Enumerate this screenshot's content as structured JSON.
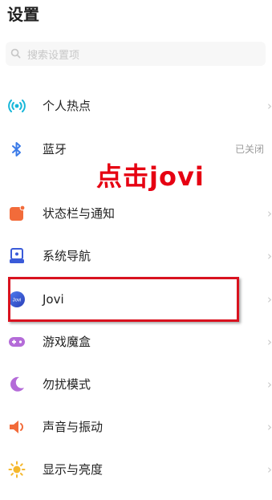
{
  "header": {
    "title": "设置"
  },
  "search": {
    "placeholder": "搜索设置项",
    "icon": "search-icon"
  },
  "rows": [
    {
      "label": "个人热点",
      "icon": "hotspot-icon",
      "icon_color": "#18b7d9"
    },
    {
      "label": "蓝牙",
      "status": "已关闭",
      "icon": "bluetooth-icon",
      "icon_color": "#3b7be8"
    },
    {
      "label": "状态栏与通知",
      "icon": "notification-icon",
      "icon_color": "#f26b3a"
    },
    {
      "label": "系统导航",
      "icon": "navigation-icon",
      "icon_color": "#3a5bd9"
    },
    {
      "label": "Jovi",
      "icon": "jovi-icon",
      "icon_color": "#3a63d8"
    },
    {
      "label": "游戏魔盒",
      "icon": "gamepad-icon",
      "icon_color": "#b46bd8"
    },
    {
      "label": "勿扰模式",
      "icon": "moon-icon",
      "icon_color": "#b46bd8"
    },
    {
      "label": "声音与振动",
      "icon": "speaker-icon",
      "icon_color": "#f26b3a"
    },
    {
      "label": "显示与亮度",
      "icon": "sun-icon",
      "icon_color": "#f5b82e"
    }
  ],
  "annotation": {
    "text": "点击jovi",
    "color": "#e60012",
    "box_color": "#d9121f"
  },
  "chevron": "›"
}
